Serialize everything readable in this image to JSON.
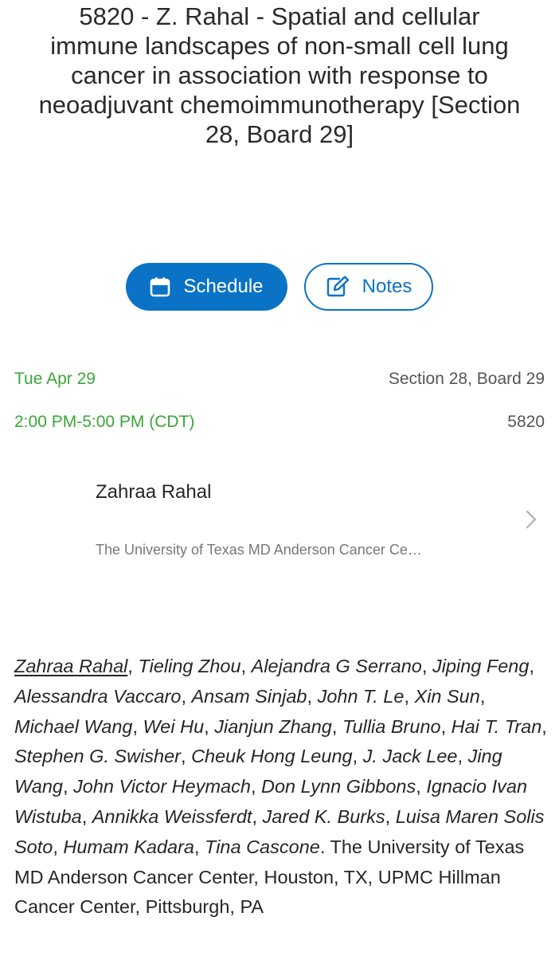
{
  "abstract": {
    "title": "5820 - Z. Rahal - Spatial and cellular immune landscapes of non-small cell lung cancer in association with response to neoadjuvant chemoimmunotherapy [Section 28, Board 29]"
  },
  "actions": {
    "schedule_label": "Schedule",
    "notes_label": "Notes",
    "accent_color": "#0a73c5"
  },
  "session": {
    "date": "Tue Apr 29",
    "time": "2:00 PM-5:00 PM (CDT)",
    "location": "Section 28, Board 29",
    "number": "5820",
    "date_color": "#3aa63a"
  },
  "presenter": {
    "name": "Zahraa Rahal",
    "affiliation": "The University of Texas MD Anderson Cancer Ce…"
  },
  "authors": {
    "names": [
      "Zahraa Rahal",
      "Tieling Zhou",
      "Alejandra G Serrano",
      "Jiping Feng",
      "Alessandra Vaccaro",
      "Ansam Sinjab",
      "John T. Le",
      "Xin Sun",
      "Michael Wang",
      "Wei Hu",
      "Jianjun Zhang",
      "Tullia Bruno",
      "Hai T. Tran",
      "Stephen G. Swisher",
      "Cheuk Hong Leung",
      "J. Jack Lee",
      "Jing Wang",
      "John Victor Heymach",
      "Don Lynn Gibbons",
      "Ignacio Ivan Wistuba",
      "Annikka Weissferdt",
      "Jared K. Burks",
      "Luisa Maren Solis Soto",
      "Humam Kadara",
      "Tina Cascone"
    ],
    "institutions": "The University of Texas MD Anderson Cancer Center, Houston, TX, UPMC Hillman Cancer Center, Pittsburgh, PA"
  }
}
